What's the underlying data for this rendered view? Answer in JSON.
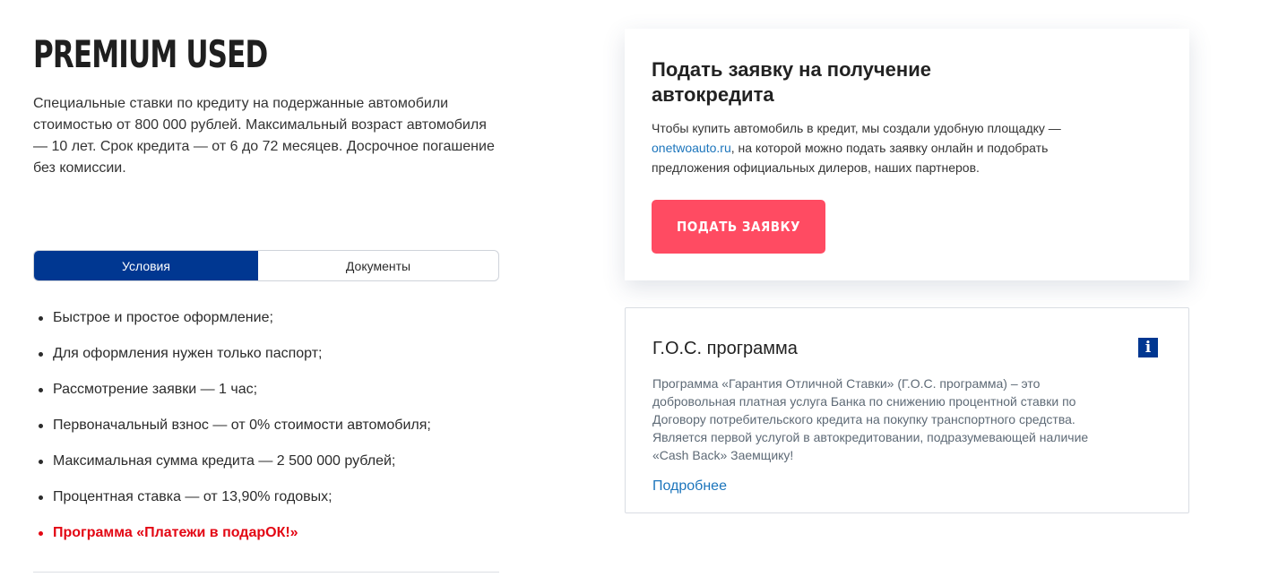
{
  "product": {
    "title": "PREMIUM USED",
    "description": "Специальные ставки по кредиту на подержанные автомобили стоимостью от 800 000 рублей. Максимальный возраст автомобиля — 10 лет. Срок кредита — от 6 до 72 месяцев. Досрочное погашение без комиссии."
  },
  "tabs": [
    {
      "label": "Условия",
      "active": true
    },
    {
      "label": "Документы",
      "active": false
    }
  ],
  "conditions": [
    "Быстрое и простое оформление;",
    "Для оформления нужен только паспорт;",
    "Рассмотрение заявки — 1 час;",
    "Первоначальный взнос — от 0% стоимости автомобиля;",
    "Максимальная сумма кредита — 2 500 000 рублей;",
    "Процентная ставка — от 13,90% годовых;",
    "Программа «Платежи в подарОК!»"
  ],
  "apply_card": {
    "title": "Подать заявку на получение автокредита",
    "text_before_link": "Чтобы купить автомобиль в кредит, мы создали удобную площадку — ",
    "link_text": "onetwoauto.ru",
    "text_after_link": ", на которой можно подать заявку онлайн и подобрать предложения официальных дилеров, наших партнеров.",
    "button_label": "ПОДАТЬ ЗАЯВКУ",
    "button_color": "#ff4b62"
  },
  "gos_card": {
    "title": "Г.О.С. программа",
    "icon": "info-icon",
    "text": "Программа «Гарантия Отличной Ставки» (Г.О.С. программа) – это добровольная платная услуга Банка по снижению процентной ставки по Договору потребительского кредита на покупку транспортного средства. Является первой услугой в автокредитовании, подразумевающей наличие «Cash Back» Заемщику!",
    "more_label": "Подробнее"
  },
  "colors": {
    "primary": "#003791",
    "accent": "#ff4b62",
    "promo": "#e30613",
    "link": "#1c75bc"
  }
}
